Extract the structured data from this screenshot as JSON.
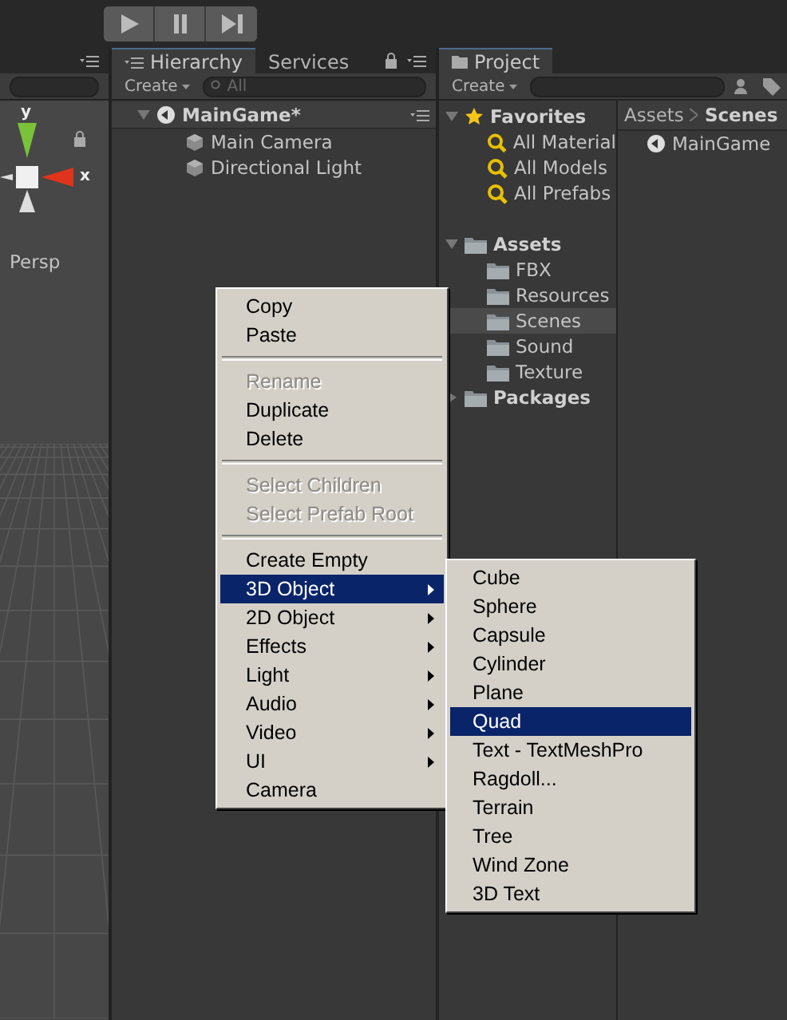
{
  "scene": {
    "axis_labels": [
      "y",
      "x"
    ],
    "view_label": "Persp"
  },
  "hierarchy": {
    "tabs": [
      {
        "label": "Hierarchy",
        "selected": true
      },
      {
        "label": "Services",
        "selected": false
      }
    ],
    "create": "Create",
    "search_placeholder": "All",
    "root": {
      "name": "MainGame*",
      "expanded": true,
      "children": [
        {
          "name": "Main Camera"
        },
        {
          "name": "Directional Light"
        }
      ]
    }
  },
  "project": {
    "tabs": [
      {
        "label": "Project",
        "selected": true
      }
    ],
    "create": "Create",
    "tree": [
      {
        "name": "Favorites",
        "kind": "favorites",
        "expanded": true,
        "children": [
          {
            "name": "All Material",
            "selected": false
          },
          {
            "name": "All Models",
            "selected": false
          },
          {
            "name": "All Prefabs",
            "selected": false
          }
        ]
      },
      {
        "name": "Assets",
        "kind": "folder",
        "expanded": true,
        "children": [
          {
            "name": "FBX",
            "selected": false
          },
          {
            "name": "Resources",
            "selected": false
          },
          {
            "name": "Scenes",
            "selected": true
          },
          {
            "name": "Sound",
            "selected": false
          },
          {
            "name": "Texture",
            "selected": false
          }
        ]
      },
      {
        "name": "Packages",
        "kind": "folder",
        "expanded": false
      }
    ],
    "breadcrumb": [
      "Assets",
      "Scenes"
    ],
    "files": [
      "MainGame"
    ]
  },
  "context_menu": {
    "groups": [
      [
        {
          "label": "Copy",
          "disabled": false,
          "selected": false,
          "submenu": false
        },
        {
          "label": "Paste",
          "disabled": false,
          "selected": false,
          "submenu": false
        }
      ],
      [
        {
          "label": "Rename",
          "disabled": true,
          "selected": false,
          "submenu": false
        },
        {
          "label": "Duplicate",
          "disabled": false,
          "selected": false,
          "submenu": false
        },
        {
          "label": "Delete",
          "disabled": false,
          "selected": false,
          "submenu": false
        }
      ],
      [
        {
          "label": "Select Children",
          "disabled": true,
          "selected": false,
          "submenu": false
        },
        {
          "label": "Select Prefab Root",
          "disabled": true,
          "selected": false,
          "submenu": false
        }
      ],
      [
        {
          "label": "Create Empty",
          "disabled": false,
          "selected": false,
          "submenu": false
        },
        {
          "label": "3D Object",
          "disabled": false,
          "selected": true,
          "submenu": true
        },
        {
          "label": "2D Object",
          "disabled": false,
          "selected": false,
          "submenu": true
        },
        {
          "label": "Effects",
          "disabled": false,
          "selected": false,
          "submenu": true
        },
        {
          "label": "Light",
          "disabled": false,
          "selected": false,
          "submenu": true
        },
        {
          "label": "Audio",
          "disabled": false,
          "selected": false,
          "submenu": true
        },
        {
          "label": "Video",
          "disabled": false,
          "selected": false,
          "submenu": true
        },
        {
          "label": "UI",
          "disabled": false,
          "selected": false,
          "submenu": true
        },
        {
          "label": "Camera",
          "disabled": false,
          "selected": false,
          "submenu": false
        }
      ]
    ]
  },
  "submenu": {
    "items": [
      {
        "label": "Cube",
        "selected": false
      },
      {
        "label": "Sphere",
        "selected": false
      },
      {
        "label": "Capsule",
        "selected": false
      },
      {
        "label": "Cylinder",
        "selected": false
      },
      {
        "label": "Plane",
        "selected": false
      },
      {
        "label": "Quad",
        "selected": true
      },
      {
        "label": "Text - TextMeshPro",
        "selected": false
      },
      {
        "label": "Ragdoll...",
        "selected": false
      },
      {
        "label": "Terrain",
        "selected": false
      },
      {
        "label": "Tree",
        "selected": false
      },
      {
        "label": "Wind Zone",
        "selected": false
      },
      {
        "label": "3D Text",
        "selected": false
      }
    ]
  }
}
